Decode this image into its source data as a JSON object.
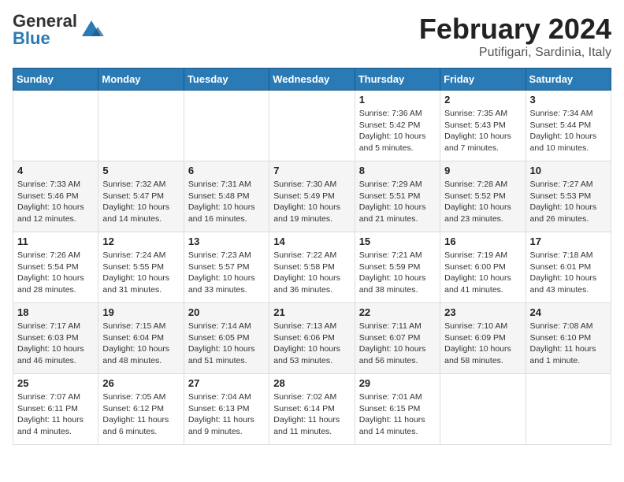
{
  "header": {
    "logo": {
      "general": "General",
      "blue": "Blue"
    },
    "title": "February 2024",
    "location": "Putifigari, Sardinia, Italy"
  },
  "calendar": {
    "days_of_week": [
      "Sunday",
      "Monday",
      "Tuesday",
      "Wednesday",
      "Thursday",
      "Friday",
      "Saturday"
    ],
    "weeks": [
      [
        {
          "day": "",
          "detail": ""
        },
        {
          "day": "",
          "detail": ""
        },
        {
          "day": "",
          "detail": ""
        },
        {
          "day": "",
          "detail": ""
        },
        {
          "day": "1",
          "detail": "Sunrise: 7:36 AM\nSunset: 5:42 PM\nDaylight: 10 hours\nand 5 minutes."
        },
        {
          "day": "2",
          "detail": "Sunrise: 7:35 AM\nSunset: 5:43 PM\nDaylight: 10 hours\nand 7 minutes."
        },
        {
          "day": "3",
          "detail": "Sunrise: 7:34 AM\nSunset: 5:44 PM\nDaylight: 10 hours\nand 10 minutes."
        }
      ],
      [
        {
          "day": "4",
          "detail": "Sunrise: 7:33 AM\nSunset: 5:46 PM\nDaylight: 10 hours\nand 12 minutes."
        },
        {
          "day": "5",
          "detail": "Sunrise: 7:32 AM\nSunset: 5:47 PM\nDaylight: 10 hours\nand 14 minutes."
        },
        {
          "day": "6",
          "detail": "Sunrise: 7:31 AM\nSunset: 5:48 PM\nDaylight: 10 hours\nand 16 minutes."
        },
        {
          "day": "7",
          "detail": "Sunrise: 7:30 AM\nSunset: 5:49 PM\nDaylight: 10 hours\nand 19 minutes."
        },
        {
          "day": "8",
          "detail": "Sunrise: 7:29 AM\nSunset: 5:51 PM\nDaylight: 10 hours\nand 21 minutes."
        },
        {
          "day": "9",
          "detail": "Sunrise: 7:28 AM\nSunset: 5:52 PM\nDaylight: 10 hours\nand 23 minutes."
        },
        {
          "day": "10",
          "detail": "Sunrise: 7:27 AM\nSunset: 5:53 PM\nDaylight: 10 hours\nand 26 minutes."
        }
      ],
      [
        {
          "day": "11",
          "detail": "Sunrise: 7:26 AM\nSunset: 5:54 PM\nDaylight: 10 hours\nand 28 minutes."
        },
        {
          "day": "12",
          "detail": "Sunrise: 7:24 AM\nSunset: 5:55 PM\nDaylight: 10 hours\nand 31 minutes."
        },
        {
          "day": "13",
          "detail": "Sunrise: 7:23 AM\nSunset: 5:57 PM\nDaylight: 10 hours\nand 33 minutes."
        },
        {
          "day": "14",
          "detail": "Sunrise: 7:22 AM\nSunset: 5:58 PM\nDaylight: 10 hours\nand 36 minutes."
        },
        {
          "day": "15",
          "detail": "Sunrise: 7:21 AM\nSunset: 5:59 PM\nDaylight: 10 hours\nand 38 minutes."
        },
        {
          "day": "16",
          "detail": "Sunrise: 7:19 AM\nSunset: 6:00 PM\nDaylight: 10 hours\nand 41 minutes."
        },
        {
          "day": "17",
          "detail": "Sunrise: 7:18 AM\nSunset: 6:01 PM\nDaylight: 10 hours\nand 43 minutes."
        }
      ],
      [
        {
          "day": "18",
          "detail": "Sunrise: 7:17 AM\nSunset: 6:03 PM\nDaylight: 10 hours\nand 46 minutes."
        },
        {
          "day": "19",
          "detail": "Sunrise: 7:15 AM\nSunset: 6:04 PM\nDaylight: 10 hours\nand 48 minutes."
        },
        {
          "day": "20",
          "detail": "Sunrise: 7:14 AM\nSunset: 6:05 PM\nDaylight: 10 hours\nand 51 minutes."
        },
        {
          "day": "21",
          "detail": "Sunrise: 7:13 AM\nSunset: 6:06 PM\nDaylight: 10 hours\nand 53 minutes."
        },
        {
          "day": "22",
          "detail": "Sunrise: 7:11 AM\nSunset: 6:07 PM\nDaylight: 10 hours\nand 56 minutes."
        },
        {
          "day": "23",
          "detail": "Sunrise: 7:10 AM\nSunset: 6:09 PM\nDaylight: 10 hours\nand 58 minutes."
        },
        {
          "day": "24",
          "detail": "Sunrise: 7:08 AM\nSunset: 6:10 PM\nDaylight: 11 hours\nand 1 minute."
        }
      ],
      [
        {
          "day": "25",
          "detail": "Sunrise: 7:07 AM\nSunset: 6:11 PM\nDaylight: 11 hours\nand 4 minutes."
        },
        {
          "day": "26",
          "detail": "Sunrise: 7:05 AM\nSunset: 6:12 PM\nDaylight: 11 hours\nand 6 minutes."
        },
        {
          "day": "27",
          "detail": "Sunrise: 7:04 AM\nSunset: 6:13 PM\nDaylight: 11 hours\nand 9 minutes."
        },
        {
          "day": "28",
          "detail": "Sunrise: 7:02 AM\nSunset: 6:14 PM\nDaylight: 11 hours\nand 11 minutes."
        },
        {
          "day": "29",
          "detail": "Sunrise: 7:01 AM\nSunset: 6:15 PM\nDaylight: 11 hours\nand 14 minutes."
        },
        {
          "day": "",
          "detail": ""
        },
        {
          "day": "",
          "detail": ""
        }
      ]
    ]
  }
}
